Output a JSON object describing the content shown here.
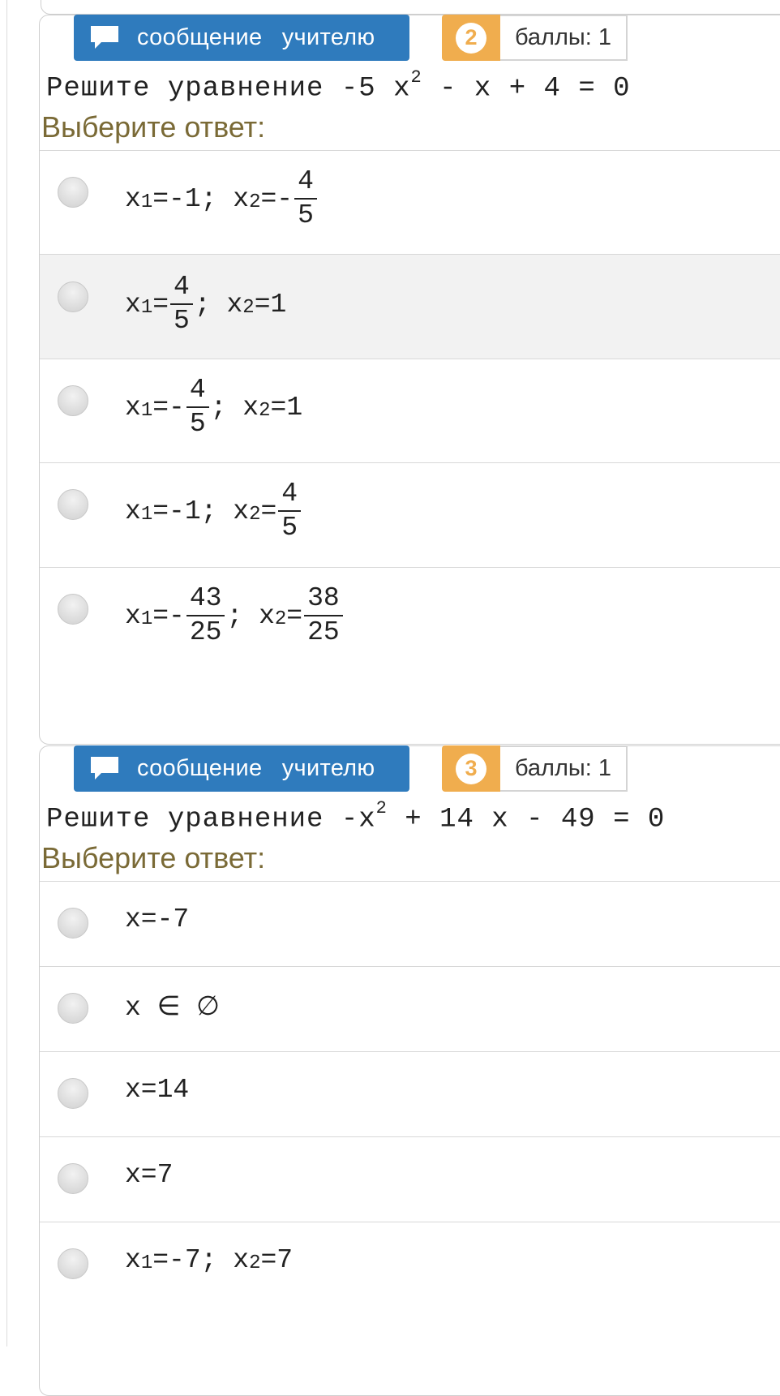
{
  "message_button": {
    "label": "сообщение учителю",
    "icon": "speech-bubble-icon"
  },
  "colors": {
    "button_blue": "#2f7bbd",
    "badge_orange": "#f0ad4e",
    "prompt_brown": "#7a6a36"
  },
  "questions": [
    {
      "number": "2",
      "points": "баллы: 1",
      "text_prefix": "Решите уравнение ",
      "equation": {
        "a": "-5 x",
        "exp": "2",
        "rest": " - x + 4 = 0"
      },
      "prompt": "Выберите ответ:",
      "options": [
        {
          "x1_sign": "-1;",
          "x2_sign": "-",
          "x2_num": "4",
          "x2_den": "5"
        },
        {
          "x1_num": "4",
          "x1_den": "5",
          "x2": "1"
        },
        {
          "x1_sign": "-",
          "x1_num": "4",
          "x1_den": "5",
          "x2": "1"
        },
        {
          "x1": "-1;",
          "x2_num": "4",
          "x2_den": "5"
        },
        {
          "x1_sign": "-",
          "x1_num": "43",
          "x1_den": "25",
          "x2_num": "38",
          "x2_den": "25"
        }
      ]
    },
    {
      "number": "3",
      "points": "баллы: 1",
      "text_prefix": "Решите уравнение ",
      "equation": {
        "a": "-x",
        "exp": "2",
        "rest": " + 14 x - 49 = 0"
      },
      "prompt": "Выберите ответ:",
      "options": [
        {
          "text": "x=-7"
        },
        {
          "text": "x ∈ ∅"
        },
        {
          "text": "x=14"
        },
        {
          "text": "x=7"
        },
        {
          "x1": "-7;",
          "x2": "7"
        }
      ]
    }
  ],
  "labels": {
    "x": "x",
    "sub1": "1",
    "sub2": "2",
    "eq": "=",
    "semicolon": ";"
  }
}
